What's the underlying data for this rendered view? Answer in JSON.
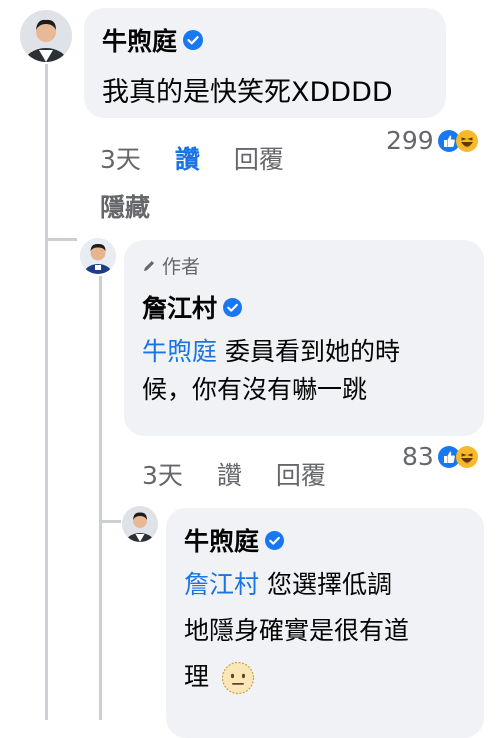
{
  "comment1": {
    "author": "牛煦庭",
    "text": "我真的是快笑死XDDDD",
    "time": "3天",
    "like_label": "讚",
    "reply_label": "回覆",
    "hide_label": "隱藏",
    "reaction_count": "299"
  },
  "reply1": {
    "author_badge": "作者",
    "author": "詹江村",
    "mention": "牛煦庭",
    "text_line1": " 委員看到她的時",
    "text_line2": "候，你有沒有嚇一跳",
    "time": "3天",
    "like_label": "讚",
    "reply_label": "回覆",
    "reaction_count": "83"
  },
  "reply2": {
    "author": "牛煦庭",
    "mention": "詹江村",
    "text_line1": " 您選擇低調",
    "text_line2": "地隱身確實是很有道",
    "text_line3": "理"
  },
  "colors": {
    "bubble": "#f0f2f5",
    "link": "#1b74e4",
    "meta": "#65676b",
    "verified": "#1877f2"
  },
  "icons": [
    "verified-badge-icon",
    "like-reaction-icon",
    "haha-reaction-icon",
    "pencil-icon",
    "neutral-face-emoji-icon"
  ]
}
